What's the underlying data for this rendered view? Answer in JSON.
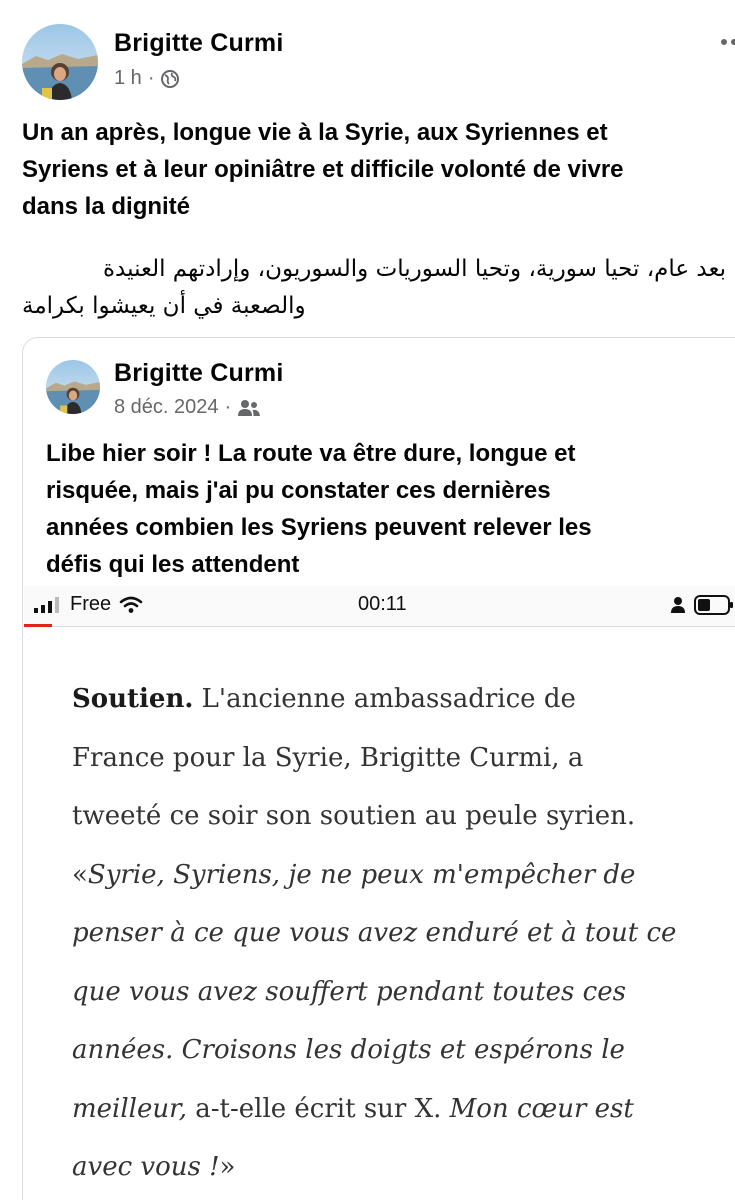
{
  "post": {
    "author": "Brigitte Curmi",
    "time": "1 h",
    "privacy_icon": "globe-icon",
    "more_icon": "more-vertical-icon",
    "text_fr_lines": [
      "Un an après, longue vie à la Syrie, aux Syriennes et",
      "Syriens et à leur opiniâtre et difficile volonté de vivre",
      "dans la dignité"
    ],
    "text_ar_lines": [
      "بعد عام، تحيا سورية، وتحيا السوريات والسوريون، وإرادتهم العنيدة",
      "والصعبة في أن يعيشوا بكرامة"
    ]
  },
  "shared_post": {
    "author": "Brigitte Curmi",
    "date": "8 déc. 2024",
    "audience_icon": "friends-icon",
    "text_lines": [
      "Libe hier soir ! La route va être dure, longue et",
      "risquée, mais j'ai pu constater ces dernières",
      "années combien les Syriens peuvent relever les",
      "défis qui les attendent"
    ]
  },
  "screenshot": {
    "status_bar": {
      "carrier": "Free",
      "time": "00:11"
    },
    "progress_fraction": 0.04,
    "accent_color": "#e2231a",
    "article": {
      "lead": "Soutien.",
      "line1_rest": " L'ancienne ambassadrice de",
      "line2": "France pour la Syrie, Brigitte Curmi, a",
      "line3": "tweeté ce soir son soutien au peule syrien.",
      "line4_open": "«",
      "line4_italic": "Syrie, Syriens, je ne peux m'empêcher de",
      "line5": "penser à ce que vous avez enduré et à tout ce",
      "line6": "que vous avez souffert pendant toutes ces",
      "line7": "années. Croisons les doigts et espérons le",
      "line8_italic": "meilleur,",
      "line8_plain": " a-t-elle écrit sur X. ",
      "line8_italic2": "Mon cœur est",
      "line9_italic": "avec vous !",
      "line9_close": "»"
    }
  }
}
